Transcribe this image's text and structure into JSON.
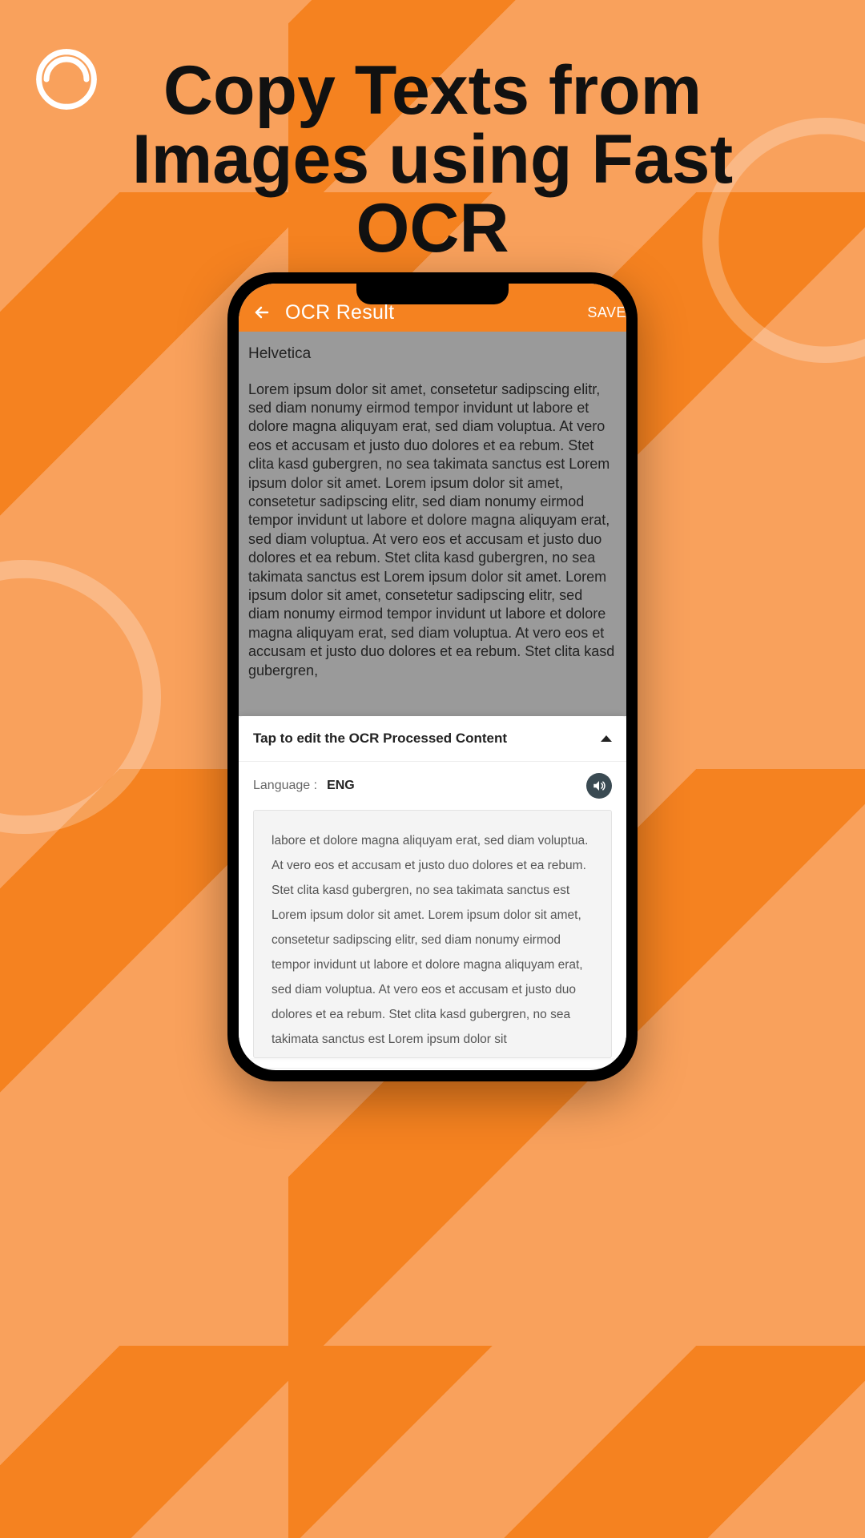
{
  "promo": {
    "headline": "Copy Texts from Images using Fast OCR"
  },
  "appbar": {
    "title": "OCR Result",
    "save_label": "SAVE"
  },
  "ocr_preview": {
    "font_name": "Helvetica",
    "body": "Lorem ipsum dolor sit amet, consetetur sadipscing elitr, sed diam nonumy eirmod tempor invidunt ut labore et dolore magna aliquyam erat, sed diam voluptua. At vero eos et accusam et justo duo dolores et ea rebum. Stet clita kasd gubergren, no sea takimata sanctus est Lorem ipsum dolor sit amet. Lorem ipsum dolor sit amet, consetetur sadipscing elitr, sed diam nonumy eirmod tempor invidunt ut labore et dolore magna aliquyam erat, sed diam voluptua. At vero eos et accusam et justo duo dolores et ea rebum. Stet clita kasd gubergren, no sea takimata sanctus est Lorem ipsum dolor sit amet. Lorem ipsum dolor sit amet, consetetur sadipscing elitr, sed diam nonumy eirmod tempor invidunt ut labore et dolore magna aliquyam erat, sed diam voluptua. At vero eos et accusam et justo duo dolores et ea rebum. Stet clita kasd gubergren,"
  },
  "sheet": {
    "header_label": "Tap to edit the OCR Processed Content",
    "language_label": "Language :",
    "language_value": "ENG",
    "edit_text": "labore et dolore magna aliquyam erat, sed diam voluptua. At vero eos et accusam et justo duo dolores et ea rebum. Stet clita kasd gubergren, no sea takimata sanctus est Lorem ipsum dolor sit amet. Lorem ipsum dolor sit amet, consetetur sadipscing elitr, sed diam nonumy eirmod tempor invidunt ut labore et dolore magna aliquyam erat, sed diam voluptua. At vero eos et accusam et justo duo dolores et ea rebum. Stet clita kasd gubergren, no sea takimata sanctus est Lorem ipsum dolor sit"
  },
  "icons": {
    "back": "back-arrow",
    "audio": "speaker",
    "nav_ocr": "ocr",
    "nav_copy": "copy",
    "nav_collapse": "collapse"
  }
}
